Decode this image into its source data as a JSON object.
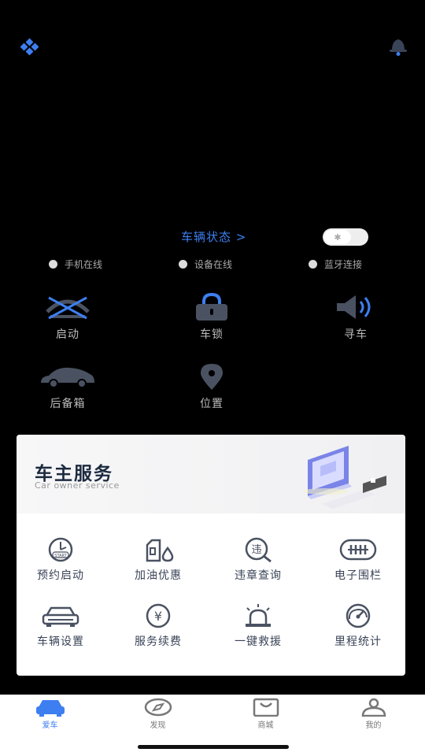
{
  "header": {
    "left_icon": "grid-dots-icon",
    "right_icon": "bell-icon"
  },
  "vehicle": {
    "status_link": "车辆状态 >",
    "bluetooth_toggle_icon": "bluetooth-icon",
    "indicators": [
      "手机在线",
      "设备在线",
      "蓝牙连接"
    ]
  },
  "controls": [
    {
      "label": "启动",
      "icon": "engine-start-icon"
    },
    {
      "label": "车锁",
      "icon": "lock-icon"
    },
    {
      "label": "寻车",
      "icon": "horn-icon"
    },
    {
      "label": "后备箱",
      "icon": "car-trunk-icon"
    },
    {
      "label": "位置",
      "icon": "location-pin-icon"
    }
  ],
  "service_card": {
    "title": "车主服务",
    "subtitle": "Car owner service",
    "items": [
      {
        "label": "预约启动",
        "icon": "clock-start-icon"
      },
      {
        "label": "加油优惠",
        "icon": "fuel-icon"
      },
      {
        "label": "违章查询",
        "icon": "violation-search-icon"
      },
      {
        "label": "电子围栏",
        "icon": "fence-icon"
      },
      {
        "label": "车辆设置",
        "icon": "car-settings-icon"
      },
      {
        "label": "服务续费",
        "icon": "yen-icon"
      },
      {
        "label": "一键救援",
        "icon": "alarm-light-icon"
      },
      {
        "label": "里程统计",
        "icon": "gauge-icon"
      }
    ]
  },
  "tabs": [
    {
      "label": "爱车",
      "icon": "car-icon",
      "active": true
    },
    {
      "label": "发现",
      "icon": "compass-icon",
      "active": false
    },
    {
      "label": "商城",
      "icon": "shopping-bag-icon",
      "active": false
    },
    {
      "label": "我的",
      "icon": "user-icon",
      "active": false
    }
  ],
  "colors": {
    "accent": "#3d7ff0",
    "icon_gray": "#4a5262",
    "card_text": "#3a4458"
  }
}
